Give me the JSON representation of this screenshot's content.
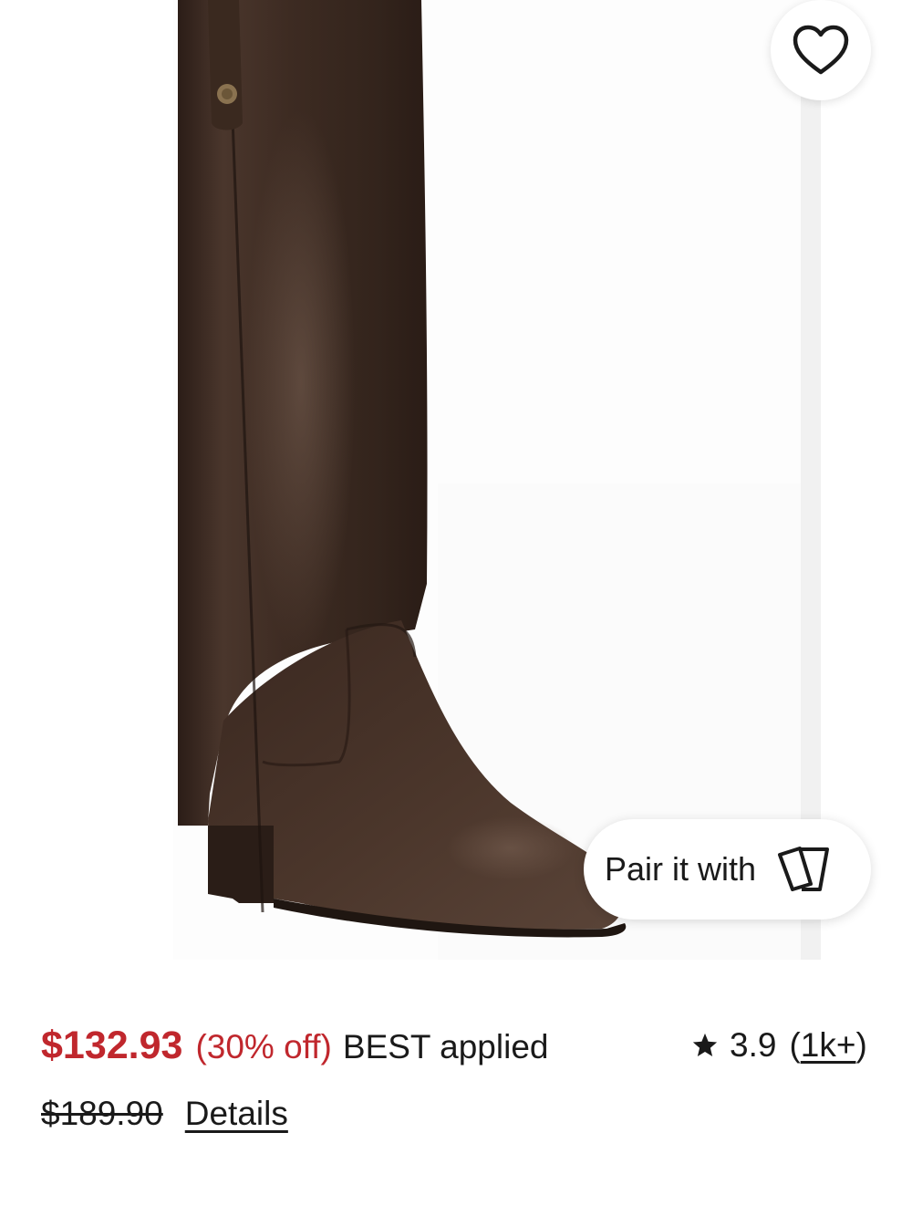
{
  "product": {
    "image_alt_icon": "boot-image",
    "sale_price": "$132.93",
    "discount": "(30% off)",
    "promo": "BEST applied",
    "original_price": "$189.90",
    "details_label": "Details"
  },
  "rating": {
    "icon": "star-icon",
    "value": "3.9",
    "open_paren": "(",
    "count": "1k+",
    "close_paren": ")"
  },
  "actions": {
    "favorite_icon": "heart-icon",
    "pair_label": "Pair it with",
    "pair_icon": "cards-icon"
  },
  "colors": {
    "sale": "#c0272d",
    "text": "#1a1a1a",
    "boot": "#3b2a22"
  }
}
